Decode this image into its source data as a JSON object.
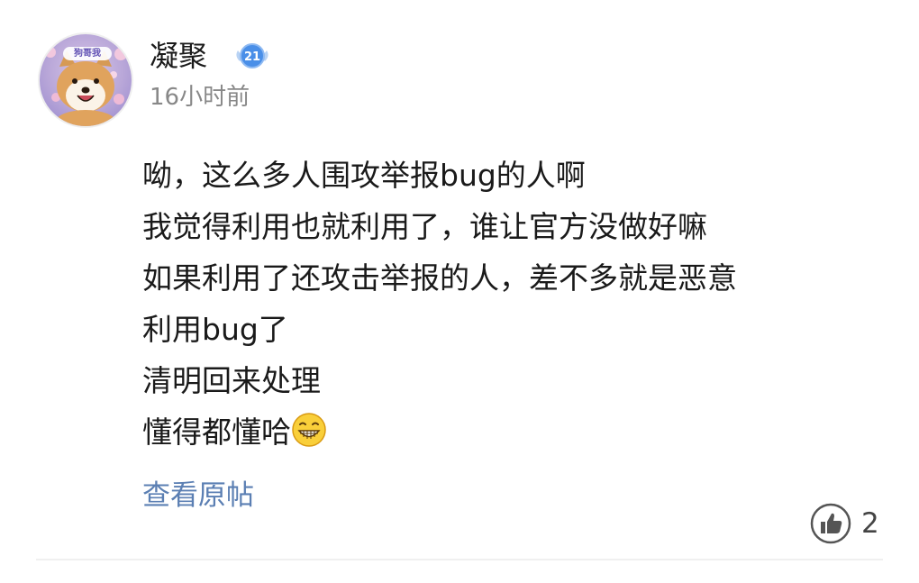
{
  "header": {
    "avatar_label": "狗哥我",
    "username": "凝聚",
    "level_badge": "21",
    "timestamp": "16小时前"
  },
  "comment": {
    "lines": [
      "呦，这么多人围攻举报bug的人啊",
      "我觉得利用也就利用了，谁让官方没做好嘛",
      "如果利用了还攻击举报的人，差不多就是恶意",
      "利用bug了",
      "清明回来处理",
      "懂得都懂哈"
    ],
    "trailing_emoji": "grin-emoji"
  },
  "footer": {
    "view_original": "查看原帖",
    "like_count": "2"
  },
  "colors": {
    "link": "#5b7fb3",
    "timestamp": "#888888",
    "badge": "#4a8fe8"
  }
}
